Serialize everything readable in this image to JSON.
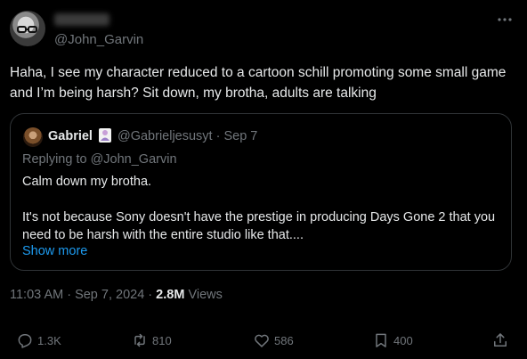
{
  "post": {
    "handle": "@John_Garvin",
    "text": "Haha, I see my character reduced to a cartoon schill promoting some small game and I’m being harsh? Sit down, my brotha, adults are talking"
  },
  "quote": {
    "name": "Gabriel",
    "handle_date": "@Gabrieljesusyt · Sep 7",
    "replying_to": "Replying to @John_Garvin",
    "line1": "Calm down my brotha.",
    "line2": "It's not because Sony doesn't have the prestige in producing Days Gone 2 that you need to be harsh with the entire studio like that....",
    "show_more": "Show more"
  },
  "meta": {
    "time_date": "11:03 AM · Sep 7, 2024 · ",
    "views_count": "2.8M",
    "views_label": " Views"
  },
  "actions": {
    "replies": "1.3K",
    "reposts": "810",
    "likes": "586",
    "bookmarks": "400"
  },
  "icons": {
    "reply": "reply-icon",
    "repost": "repost-icon",
    "like": "heart-icon",
    "bookmark": "bookmark-icon",
    "share": "share-icon",
    "more": "more-icon"
  },
  "colors": {
    "background": "#000000",
    "text": "#e7e9ea",
    "muted": "#71767b",
    "link": "#1d9bf0",
    "border": "#2f3336"
  }
}
